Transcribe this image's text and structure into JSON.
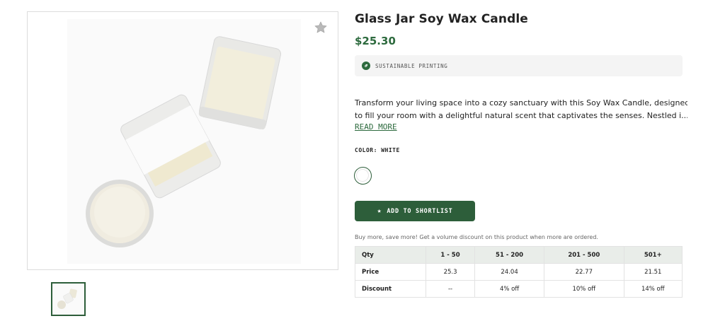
{
  "product": {
    "title": "Glass Jar Soy Wax Candle",
    "price": "$25.30",
    "badge": {
      "icon": "leaf-icon",
      "text": "SUSTAINABLE PRINTING"
    },
    "description_lines": [
      "Transform your living space into a cozy sanctuary with this Soy Wax Candle, designed",
      "to fill your room with a delightful natural scent that captivates the senses. Nestled i..."
    ],
    "read_more": "READ MORE",
    "color_label": "COLOR: WHITE",
    "selected_color": "#ffffff",
    "shortlist_button": "ADD TO SHORTLIST",
    "volume_note": "Buy more, save more! Get a volume discount on this product when more are ordered."
  },
  "pricing_table": {
    "headers": [
      "Qty",
      "1 - 50",
      "51 - 200",
      "201 - 500",
      "501+"
    ],
    "rows": [
      {
        "label": "Price",
        "values": [
          "25.3",
          "24.04",
          "22.77",
          "21.51"
        ]
      },
      {
        "label": "Discount",
        "values": [
          "--",
          "4% off",
          "10% off",
          "14% off"
        ]
      }
    ]
  },
  "colors": {
    "accent": "#2d5e3a",
    "price": "#2d6a3e",
    "table_header": "#e9ede9"
  },
  "icons": {
    "favorite": "star-icon",
    "shortlist": "star-icon",
    "badge": "leaf-icon"
  }
}
